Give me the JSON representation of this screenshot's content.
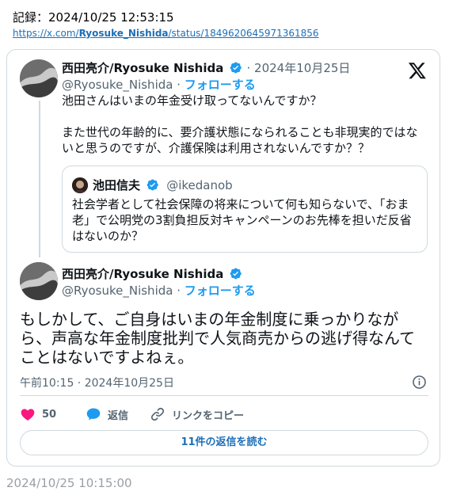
{
  "record": {
    "line": "記録：2024/10/25 12:53:15",
    "url_prefix": "https://x.com/",
    "url_user": "Ryosuke_Nishida",
    "url_suffix": "/status/1849620645971361856"
  },
  "tweet1": {
    "name": "西田亮介/Ryosuke Nishida",
    "date": "· 2024年10月25日",
    "handle": "@Ryosuke_Nishida",
    "follow_sep": " · ",
    "follow": "フォローする",
    "text_line1": "池田さんはいまの年金受け取ってないんですか？",
    "text_line2": "また世代の年齢的に、要介護状態になられることも非現実的ではな",
    "text_line3": "いと思うのですが、介護保険は利用されないんですか？？"
  },
  "quote": {
    "name": "池田信夫",
    "handle": "@ikedanob",
    "text_line1": "社会学者として社会保障の将来について何も知らないで、「おま",
    "text_line2": "老」で公明党の3割負担反対キャンペーンのお先棒を担いだ反省",
    "text_line3": "はないのか？"
  },
  "tweet2": {
    "name": "西田亮介/Ryosuke Nishida",
    "handle": "@Ryosuke_Nishida",
    "follow_sep": " · ",
    "follow": "フォローする",
    "text_line1": "もしかして、ご自身はいまの年金制度に乗っかりなが",
    "text_line2": "ら、声高な年金制度批判で人気商売からの逃げ得なんて",
    "text_line3": "ことはないですよねぇ。",
    "timestamp": "午前10:15 · 2024年10月25日"
  },
  "actions": {
    "like_count": "50",
    "reply_label": "返信",
    "copy_link_label": "リンクをコピー"
  },
  "read_replies": "11件の返信を読む",
  "footer_time": "2024/10/25 10:15:00",
  "colors": {
    "accent": "#1d9bf0",
    "like": "#f91880",
    "border": "#cfd9de",
    "muted": "#536471"
  },
  "icons": [
    "x-logo-icon",
    "verified-badge-icon",
    "info-icon",
    "heart-icon",
    "reply-bubble-icon",
    "link-icon"
  ]
}
